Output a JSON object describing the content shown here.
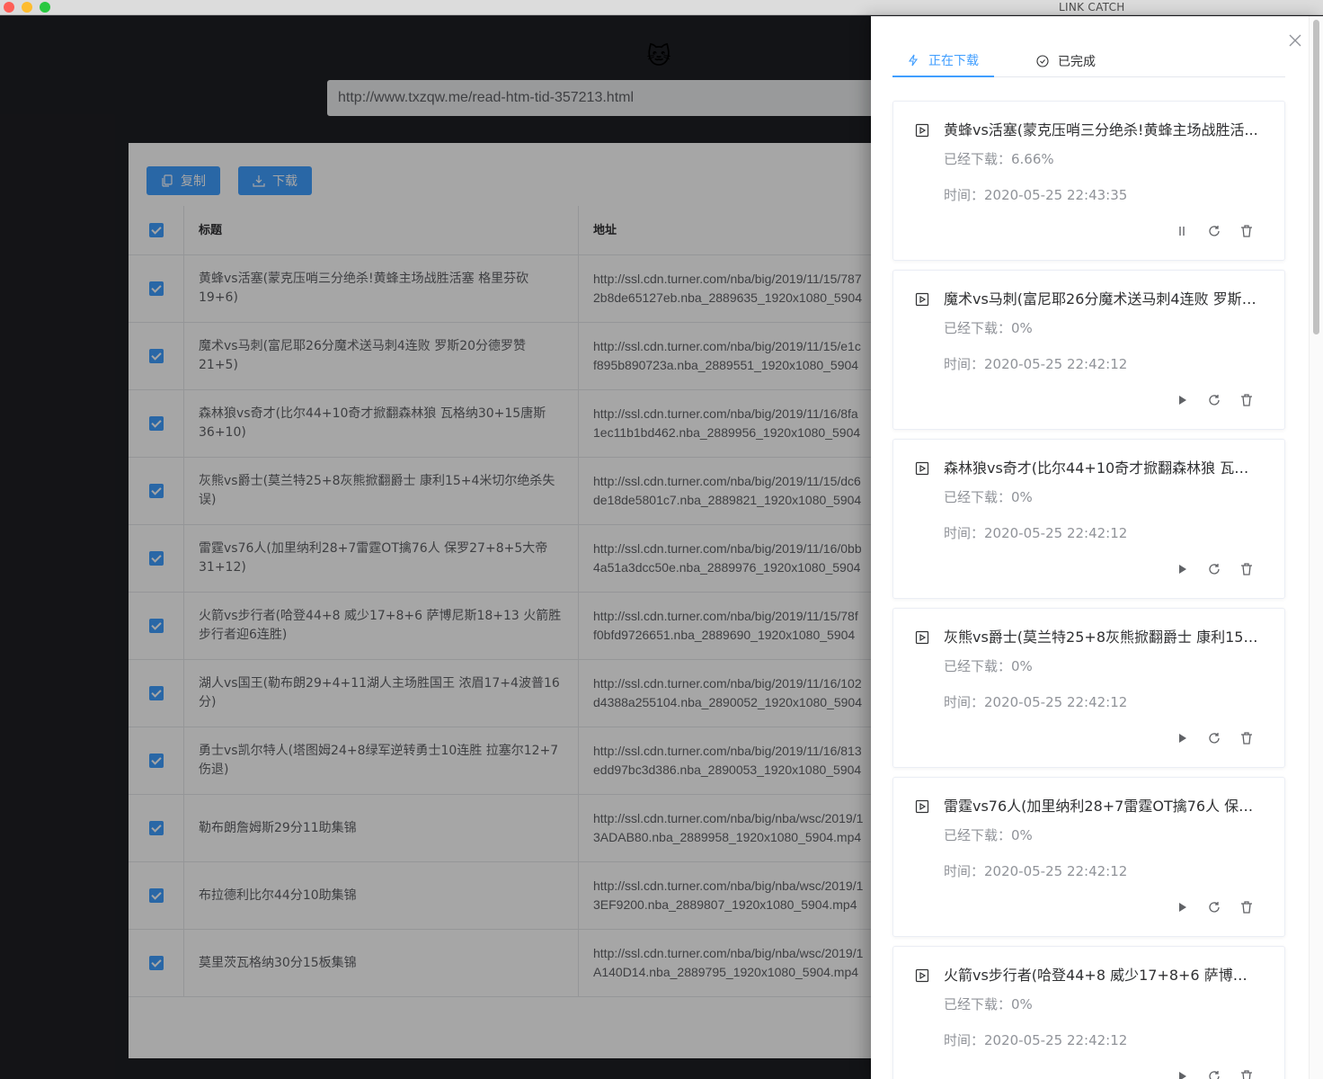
{
  "window": {
    "title": "LINK CATCH"
  },
  "app": {
    "logo_emoji": "🐱",
    "url_value": "http://www.txzqw.me/read-htm-tid-357213.html",
    "toolbar": {
      "copy_label": "复制",
      "download_label": "下载"
    },
    "table": {
      "headers": {
        "title": "标题",
        "url": "地址"
      },
      "rows": [
        {
          "title": "黄蜂vs活塞(蒙克压哨三分绝杀!黄蜂主场战胜活塞 格里芬砍19+6)",
          "url1": "http://ssl.cdn.turner.com/nba/big/2019/11/15/787",
          "url2": "2b8de65127eb.nba_2889635_1920x1080_5904"
        },
        {
          "title": "魔术vs马刺(富尼耶26分魔术送马刺4连败 罗斯20分德罗赞21+5)",
          "url1": "http://ssl.cdn.turner.com/nba/big/2019/11/15/e1c",
          "url2": "f895b890723a.nba_2889551_1920x1080_5904"
        },
        {
          "title": "森林狼vs奇才(比尔44+10奇才掀翻森林狼 瓦格纳30+15唐斯36+10)",
          "url1": "http://ssl.cdn.turner.com/nba/big/2019/11/16/8fa",
          "url2": "1ec11b1bd462.nba_2889956_1920x1080_5904"
        },
        {
          "title": "灰熊vs爵士(莫兰特25+8灰熊掀翻爵士 康利15+4米切尔绝杀失误)",
          "url1": "http://ssl.cdn.turner.com/nba/big/2019/11/15/dc6",
          "url2": "de18de5801c7.nba_2889821_1920x1080_5904"
        },
        {
          "title": "雷霆vs76人(加里纳利28+7雷霆OT擒76人 保罗27+8+5大帝31+12)",
          "url1": "http://ssl.cdn.turner.com/nba/big/2019/11/16/0bb",
          "url2": "4a51a3dcc50e.nba_2889976_1920x1080_5904"
        },
        {
          "title": "火箭vs步行者(哈登44+8 威少17+8+6 萨博尼斯18+13 火箭胜步行者迎6连胜)",
          "url1": "http://ssl.cdn.turner.com/nba/big/2019/11/15/78f",
          "url2": "f0bfd9726651.nba_2889690_1920x1080_5904"
        },
        {
          "title": "湖人vs国王(勒布朗29+4+11湖人主场胜国王 浓眉17+4波普16分)",
          "url1": "http://ssl.cdn.turner.com/nba/big/2019/11/16/102",
          "url2": "d4388a255104.nba_2890052_1920x1080_5904"
        },
        {
          "title": "勇士vs凯尔特人(塔图姆24+8绿军逆转勇士10连胜 拉塞尔12+7伤退)",
          "url1": "http://ssl.cdn.turner.com/nba/big/2019/11/16/813",
          "url2": "edd97bc3d386.nba_2890053_1920x1080_5904"
        },
        {
          "title": "勒布朗詹姆斯29分11助集锦",
          "url1": "http://ssl.cdn.turner.com/nba/big/nba/wsc/2019/1",
          "url2": "3ADAB80.nba_2889958_1920x1080_5904.mp4"
        },
        {
          "title": "布拉德利比尔44分10助集锦",
          "url1": "http://ssl.cdn.turner.com/nba/big/nba/wsc/2019/1",
          "url2": "3EF9200.nba_2889807_1920x1080_5904.mp4"
        },
        {
          "title": "莫里茨瓦格纳30分15板集锦",
          "url1": "http://ssl.cdn.turner.com/nba/big/nba/wsc/2019/1",
          "url2": "A140D14.nba_2889795_1920x1080_5904.mp4"
        }
      ]
    }
  },
  "drawer": {
    "tabs": {
      "downloading": "正在下载",
      "completed": "已完成"
    },
    "items": [
      {
        "title": "黄蜂vs活塞(蒙克压哨三分绝杀!黄蜂主场战胜活...",
        "progress": "已经下载：6.66%",
        "time": "时间：2020-05-25 22:43:35",
        "state": "downloading"
      },
      {
        "title": "魔术vs马刺(富尼耶26分魔术送马刺4连败 罗斯2...",
        "progress": "已经下载：0%",
        "time": "时间：2020-05-25 22:42:12",
        "state": "paused"
      },
      {
        "title": "森林狼vs奇才(比尔44+10奇才掀翻森林狼 瓦格...",
        "progress": "已经下载：0%",
        "time": "时间：2020-05-25 22:42:12",
        "state": "paused"
      },
      {
        "title": "灰熊vs爵士(莫兰特25+8灰熊掀翻爵士 康利15+...",
        "progress": "已经下载：0%",
        "time": "时间：2020-05-25 22:42:12",
        "state": "paused"
      },
      {
        "title": "雷霆vs76人(加里纳利28+7雷霆OT擒76人 保罗...",
        "progress": "已经下载：0%",
        "time": "时间：2020-05-25 22:42:12",
        "state": "paused"
      },
      {
        "title": "火箭vs步行者(哈登44+8 威少17+8+6 萨博尼斯...",
        "progress": "已经下载：0%",
        "time": "时间：2020-05-25 22:42:12",
        "state": "paused"
      }
    ]
  },
  "colors": {
    "accent": "#409eff",
    "text_primary": "#303133",
    "text_secondary": "#909399"
  }
}
